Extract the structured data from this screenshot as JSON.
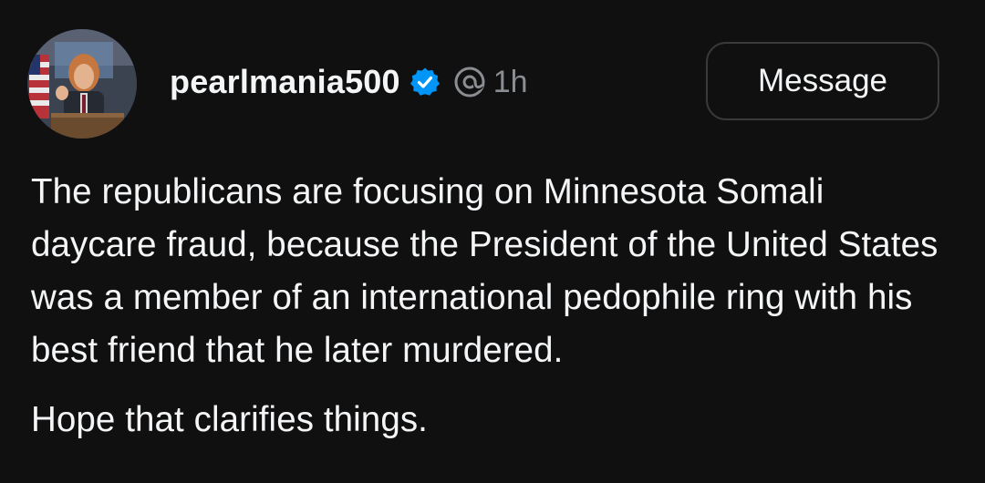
{
  "post": {
    "author": {
      "username": "pearlmania500",
      "verified": true,
      "avatar_icon": "avatar-photo-podium"
    },
    "platform_icon": "threads-icon",
    "timestamp": "1h",
    "message_button_label": "Message",
    "paragraphs": [
      "The republicans are focusing on Minnesota Somali daycare fraud, because the President of the United States was a member of an international pedophile ring with his best friend that he later murdered.",
      "Hope that clarifies things."
    ]
  },
  "colors": {
    "background": "#101010",
    "text": "#f3f5f7",
    "muted": "#8a8d91",
    "verified_blue": "#0095f6",
    "button_border": "#3a3a3a"
  }
}
